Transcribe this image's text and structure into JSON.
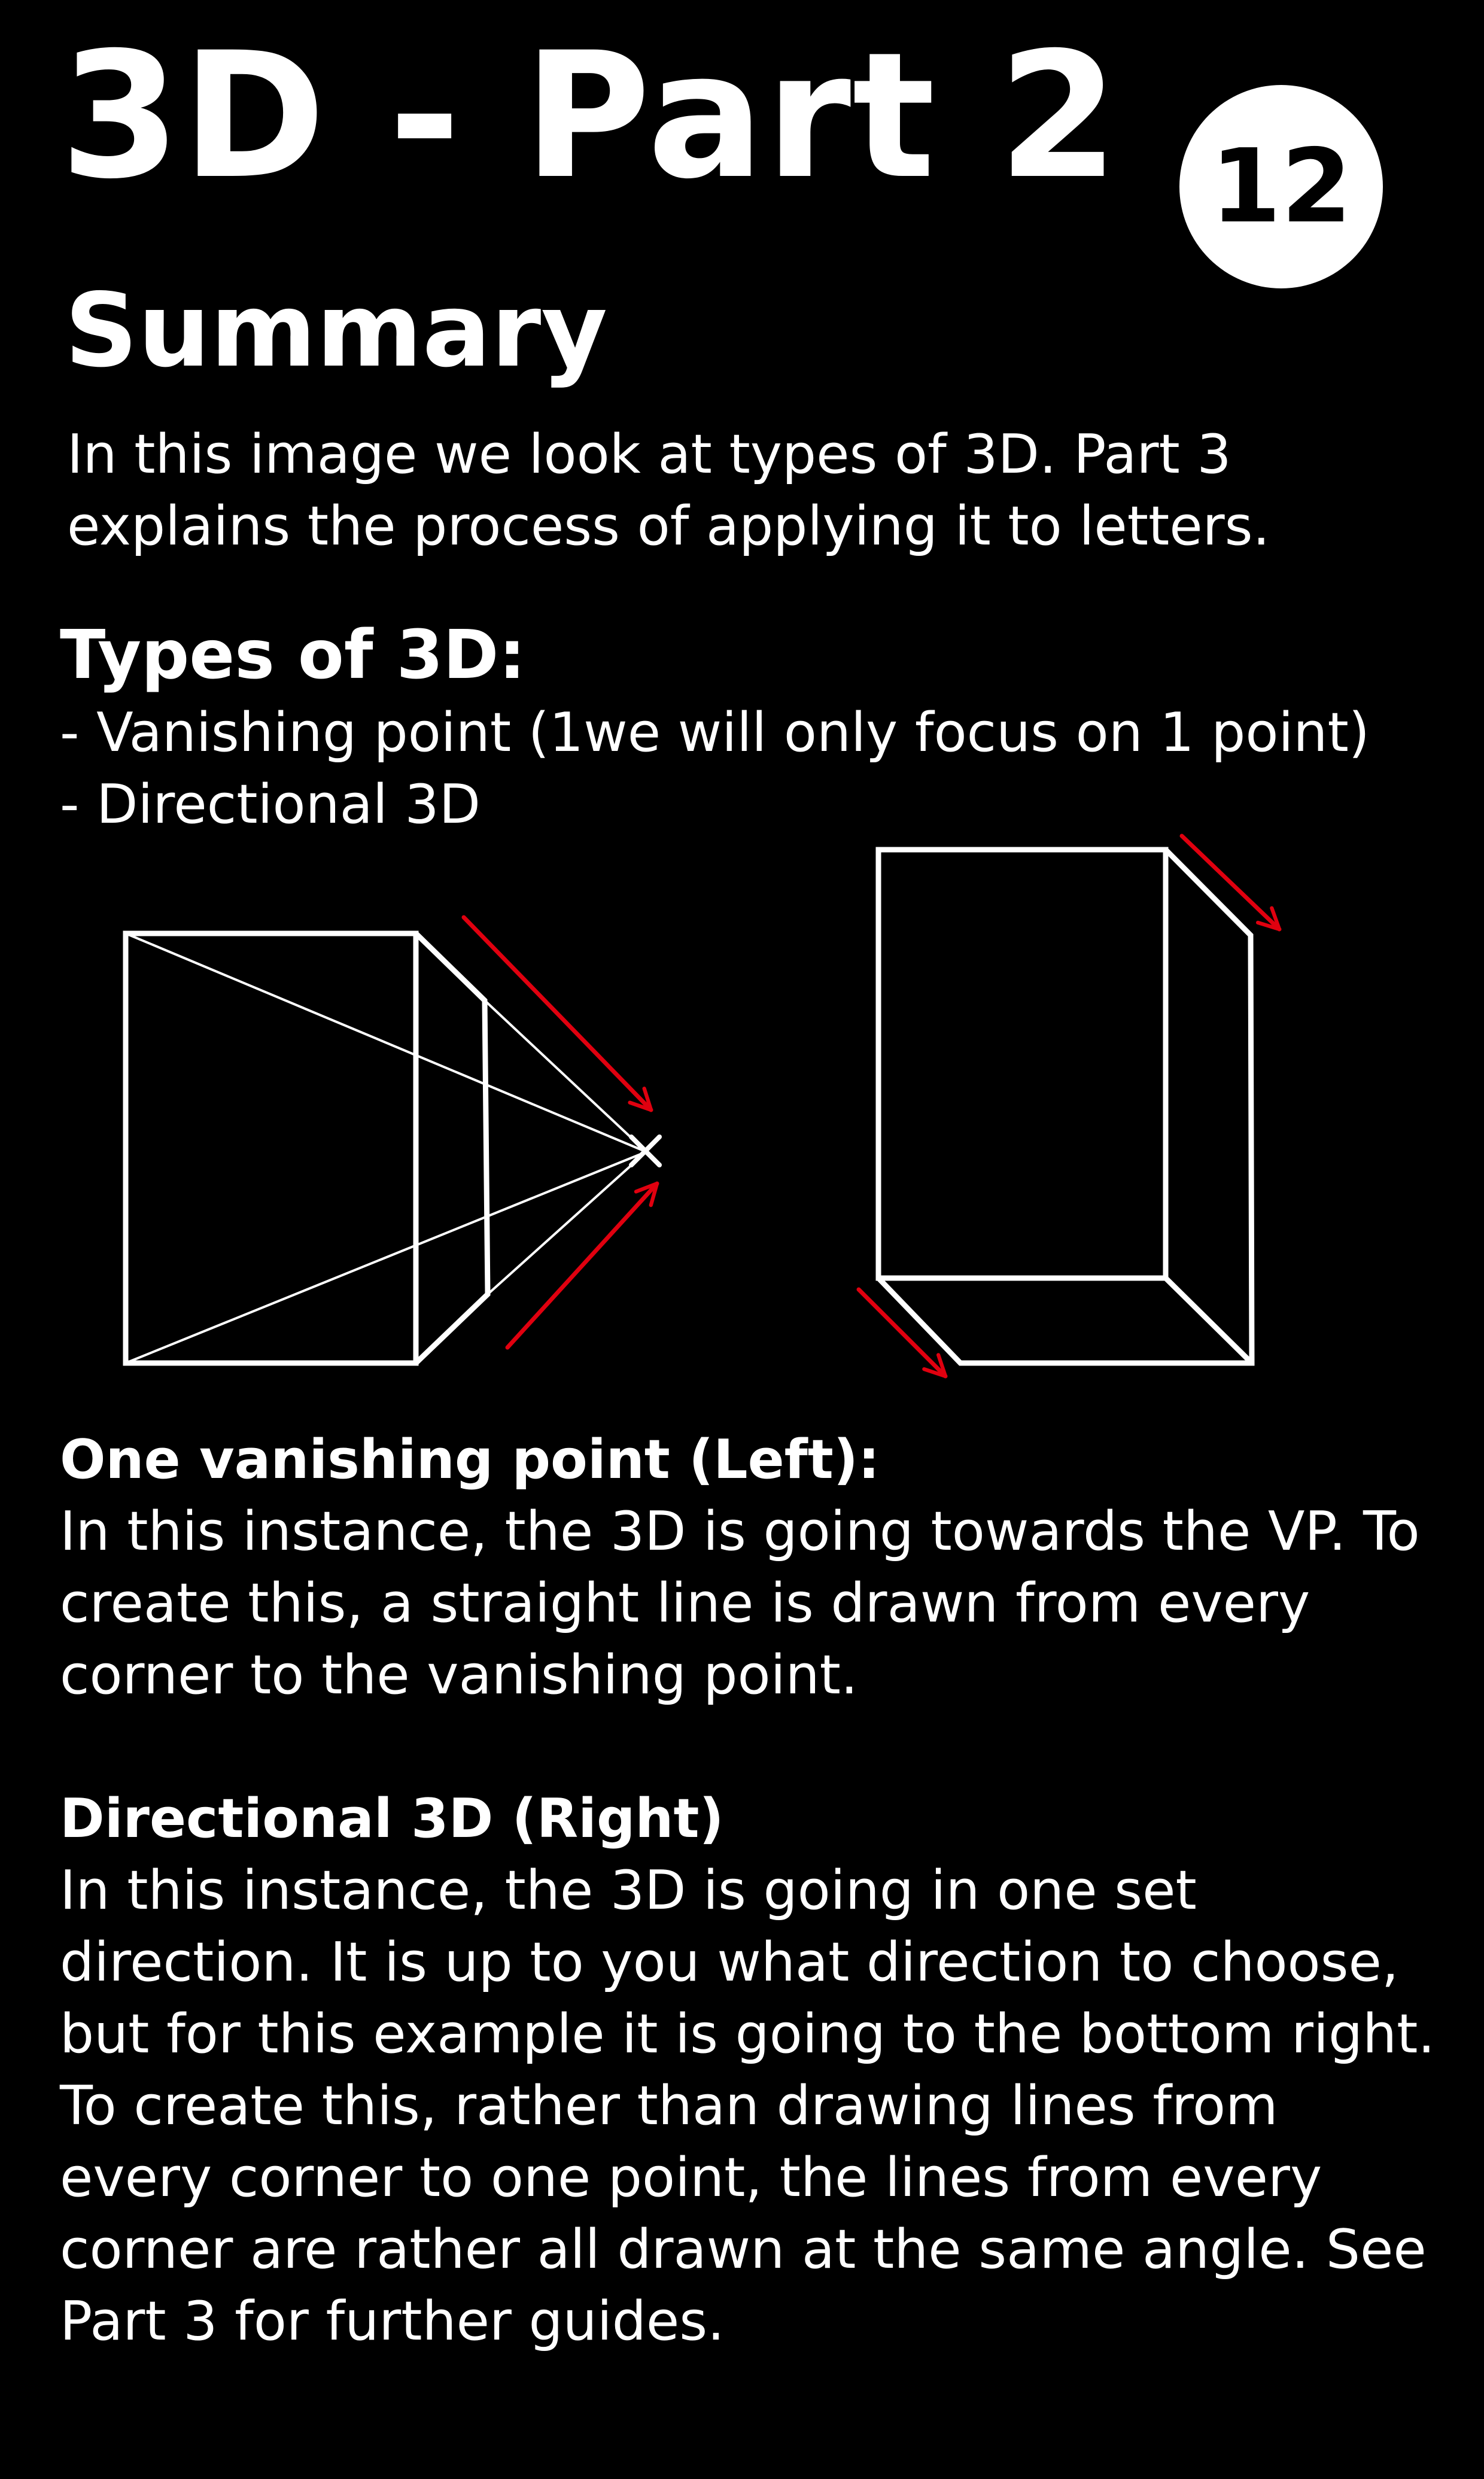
{
  "header": {
    "title": "3D - Part 2",
    "badge_number": "12"
  },
  "summary": {
    "heading": "Summary",
    "body": "In this image we look at types of 3D. Part 3 explains the process of applying it to letters."
  },
  "types": {
    "heading": "Types of 3D:",
    "items": [
      "- Vanishing point (1we will only focus on 1 point)",
      "- Directional 3D"
    ]
  },
  "diagram": {
    "line_color": "#ffffff",
    "arrow_color": "#e0000f"
  },
  "vanishing_point_section": {
    "heading": "One vanishing point (Left):",
    "body": "In this instance, the 3D is going towards the VP. To create this, a straight line is drawn from every corner to the vanishing point."
  },
  "directional_section": {
    "heading": "Directional 3D (Right)",
    "body": "In this instance, the 3D is going in one set direction. It is up to you what direction to choose, but for this example it is going to the bottom right. To create this, rather than drawing lines from every corner to one point, the lines from every corner are rather all drawn at the same angle. See Part 3 for further guides."
  }
}
